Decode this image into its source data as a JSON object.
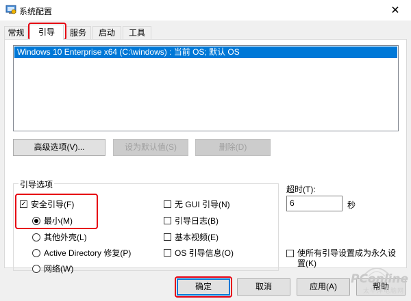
{
  "window": {
    "title": "系统配置",
    "close_glyph": "✕"
  },
  "tabs": [
    {
      "label": "常规"
    },
    {
      "label": "引导"
    },
    {
      "label": "服务"
    },
    {
      "label": "启动"
    },
    {
      "label": "工具"
    }
  ],
  "active_tab": "引导",
  "os_list": {
    "items": [
      "Windows 10 Enterprise x64 (C:\\windows) : 当前 OS; 默认 OS"
    ],
    "selected_index": 0
  },
  "list_buttons": {
    "advanced": "高级选项(V)...",
    "set_default": "设为默认值(S)",
    "delete": "删除(D)"
  },
  "boot_options": {
    "group_label": "引导选项",
    "safe_boot": {
      "label": "安全引导(F)",
      "checked": true
    },
    "minimal": {
      "label": "最小(M)",
      "selected": true
    },
    "alternate_shell": {
      "label": "其他外壳(L)",
      "selected": false
    },
    "active_directory": {
      "label": "Active Directory 修复(P)",
      "selected": false
    },
    "network": {
      "label": "网络(W)",
      "selected": false
    },
    "no_gui": {
      "label": "无 GUI 引导(N)",
      "checked": false
    },
    "boot_log": {
      "label": "引导日志(B)",
      "checked": false
    },
    "base_video": {
      "label": "基本视频(E)",
      "checked": false
    },
    "os_info": {
      "label": "OS 引导信息(O)",
      "checked": false
    }
  },
  "timeout": {
    "label": "超时(T):",
    "value": "6",
    "unit": "秒"
  },
  "make_permanent": {
    "label": "使所有引导设置成为永久设置(K)",
    "checked": false
  },
  "footer": {
    "ok": "确定",
    "cancel": "取消",
    "apply": "应用(A)",
    "help": "帮助"
  },
  "watermark": {
    "text": "PConline",
    "sub": "太平洋电脑网"
  },
  "colors": {
    "selection": "#0078d7",
    "highlight": "#e60012"
  },
  "icons": {
    "check": "✓"
  }
}
